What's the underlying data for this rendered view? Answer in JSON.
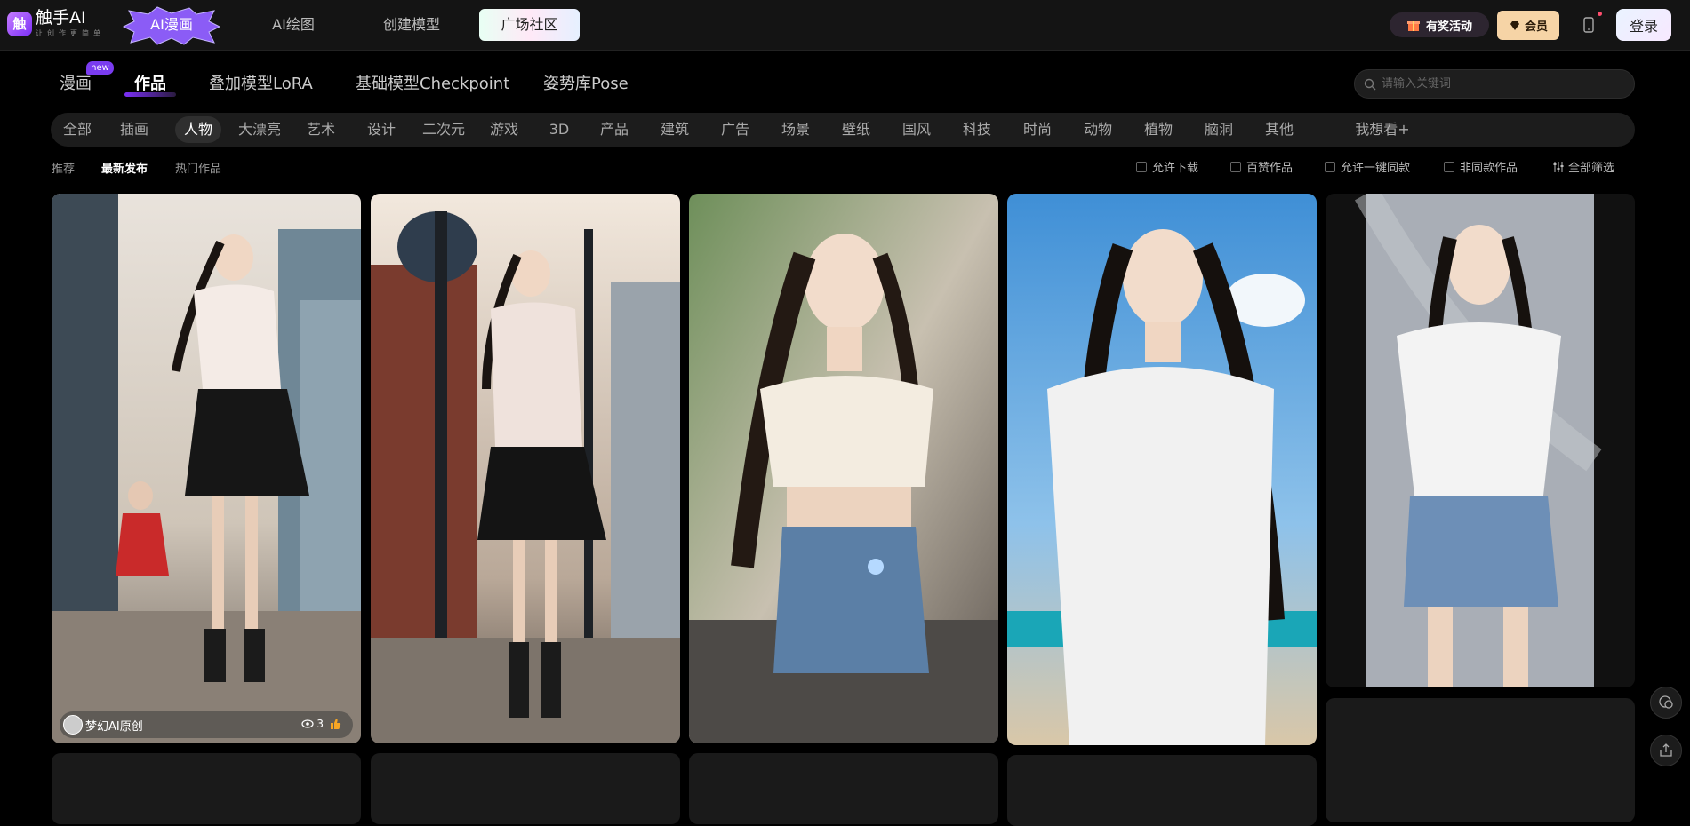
{
  "header": {
    "logo_title": "触手AI",
    "logo_sub": "让创作更简单",
    "logo_mark": "触",
    "nav": [
      "AI漫画",
      "AI绘图",
      "创建模型",
      "广场社区"
    ],
    "event_label": "有奖活动",
    "vip_label": "会员",
    "login_label": "登录"
  },
  "tabs": {
    "items": [
      "漫画",
      "作品",
      "叠加模型LoRA",
      "基础模型Checkpoint",
      "姿势库Pose"
    ],
    "active": "作品",
    "new_badge": "new",
    "search_placeholder": "请输入关键词"
  },
  "categories": [
    "全部",
    "插画",
    "人物",
    "大漂亮",
    "艺术",
    "设计",
    "二次元",
    "游戏",
    "3D",
    "产品",
    "建筑",
    "广告",
    "场景",
    "壁纸",
    "国风",
    "科技",
    "时尚",
    "动物",
    "植物",
    "脑洞",
    "其他",
    "我想看+"
  ],
  "active_category": "人物",
  "sort": [
    "推荐",
    "最新发布",
    "热门作品"
  ],
  "active_sort": "最新发布",
  "filters": [
    "允许下载",
    "百赞作品",
    "允许一键同款",
    "非同款作品"
  ],
  "filter_all_label": "全部筛选",
  "cards": [
    {
      "author": "梦幻AI原创",
      "views": "3",
      "theme": "city-ponytail-black-skirt"
    },
    {
      "theme": "street-ponytail-sweater"
    },
    {
      "theme": "offshoulder-sweater-denim"
    },
    {
      "theme": "white-dress-beach"
    },
    {
      "theme": "white-tee-denim-shorts"
    }
  ],
  "colors": {
    "accent": "#7b2ff7",
    "vip": "#f6d4a6",
    "background": "#000000"
  },
  "icons": [
    "gift-icon",
    "diamond-icon",
    "mobile-icon",
    "search-icon",
    "filter-icon",
    "eye-icon",
    "thumb-up-icon",
    "chat-icon",
    "share-icon"
  ]
}
